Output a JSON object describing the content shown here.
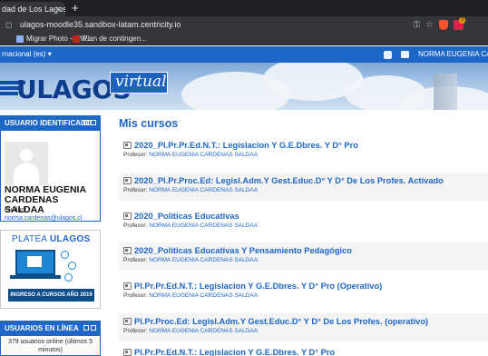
{
  "browser": {
    "tab_title": "dad de Los Lagos",
    "tab_close": "×",
    "new_tab": "+",
    "url": "ulagos-moodle35.sandbox-latam.centricity.io",
    "extension_badge": "3",
    "bookmarks": [
      {
        "label": "Migrar Photo – Pla..."
      },
      {
        "label": "Plan de contingen..."
      }
    ]
  },
  "navbar": {
    "language": "rnacional (es) ▾",
    "user": "NORMA EUGENIA CARDEN"
  },
  "banner": {
    "logo_text": "ULAGOS",
    "virtual_text": "virtual"
  },
  "sidebar": {
    "user_block": {
      "title": "USUARIO IDENTIFICADO",
      "name": "NORMA EUGENIA CARDENAS SALDAA",
      "city_label": "Ciudad:",
      "email": "norma.cardenas@ulagos.cl"
    },
    "platea": {
      "title_prefix": "PLATEA",
      "title_brand": "ULAGOS",
      "button": "INGRESO A CURSOS AÑO 2019"
    },
    "online_block": {
      "title": "USUARIOS EN LÍNEA",
      "text": "379 usuarios online (últimos 5 minutos)"
    }
  },
  "main": {
    "title": "Mis cursos",
    "prof_label": "Profesor:",
    "courses": [
      {
        "title": "2020_Pl.Pr.Pr.Ed.N.T.: Legislacion Y G.E.Dbres. Y D° Pro",
        "prof": "NORMA EUGENIA CARDENAS SALDAA"
      },
      {
        "title": "2020_Pl.Pr.Proc.Ed: Legisl.Adm.Y Gest.Educ.D° Y D° De Los Profes. Activado",
        "prof": "NORMA EUGENIA CARDENAS SALDAA"
      },
      {
        "title": "2020_Políticas Educativas",
        "prof": "NORMA EUGENIA CARDENAS SALDAA"
      },
      {
        "title": "2020_Políticas Educativas Y Pensamiento Pedagógico",
        "prof": "NORMA EUGENIA CARDENAS SALDAA"
      },
      {
        "title": "Pl.Pr.Pr.Ed.N.T.: Legislacion Y G.E.Dbres. Y D° Pro (Operativo)",
        "prof": "NORMA EUGENIA CARDENAS SALDAA"
      },
      {
        "title": "Pl.Pr.Proc.Ed: Legisl.Adm.Y Gest.Educ.D° Y D° De Los Profes. (operativo)",
        "prof": "NORMA EUGENIA CARDENAS SALDAA"
      },
      {
        "title": "Pl.Pr.Pr.Ed.N.T.: Legislacion Y G.E.Dbres. Y D° Pro",
        "prof": ""
      }
    ]
  }
}
